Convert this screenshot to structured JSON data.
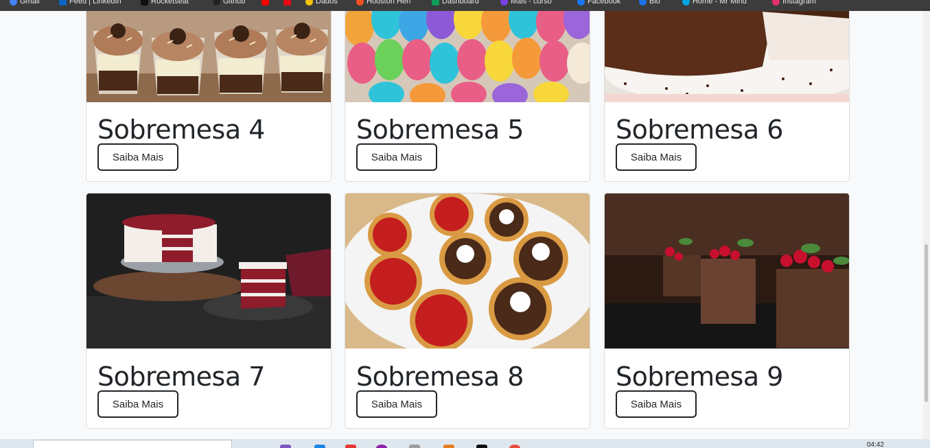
{
  "bookmarks": [
    {
      "label": "Gmail",
      "color": "#4285f4"
    },
    {
      "label": "Feed | LinkedIn",
      "color": "#0a66c2"
    },
    {
      "label": "Rocketseat",
      "color": "#111111"
    },
    {
      "label": "Github",
      "color": "#222222"
    },
    {
      "label": "",
      "color": "#ff0000"
    },
    {
      "label": "",
      "color": "#e50914"
    },
    {
      "label": "Dados",
      "color": "#f4c20d"
    },
    {
      "label": "Houston Hen",
      "color": "#f25022"
    },
    {
      "label": "Dashboard",
      "color": "#0f9d58"
    },
    {
      "label": "Mais - curso",
      "color": "#7b3fe4"
    },
    {
      "label": "Facebook",
      "color": "#1877f2"
    },
    {
      "label": "Bio",
      "color": "#1a73e8"
    },
    {
      "label": "Home - Mr Mind",
      "color": "#00a3e0"
    },
    {
      "label": "Instagram",
      "color": "#e1306c"
    }
  ],
  "cards": [
    {
      "title": "Sobremesa 4",
      "button": "Saiba Mais",
      "image": "cupcakes-in-cups-image"
    },
    {
      "title": "Sobremesa 5",
      "button": "Saiba Mais",
      "image": "macarons-image"
    },
    {
      "title": "Sobremesa 6",
      "button": "Saiba Mais",
      "image": "chocolate-cake-image"
    },
    {
      "title": "Sobremesa 7",
      "button": "Saiba Mais",
      "image": "red-velvet-cake-image"
    },
    {
      "title": "Sobremesa 8",
      "button": "Saiba Mais",
      "image": "tarts-image"
    },
    {
      "title": "Sobremesa 9",
      "button": "Saiba Mais",
      "image": "chocolate-mousse-image"
    }
  ],
  "taskbar": {
    "clock": "04:42"
  }
}
